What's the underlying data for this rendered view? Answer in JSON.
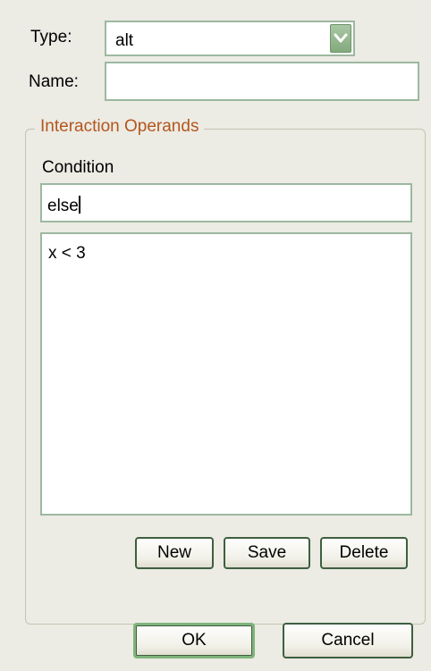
{
  "form": {
    "type_label": "Type:",
    "type_value": "alt",
    "name_label": "Name:",
    "name_value": ""
  },
  "operands": {
    "group_title": "Interaction Operands",
    "condition_label": "Condition",
    "condition_value": "else",
    "list_items": [
      "x < 3"
    ],
    "new_label": "New",
    "save_label": "Save",
    "delete_label": "Delete"
  },
  "dialog": {
    "ok_label": "OK",
    "cancel_label": "Cancel"
  },
  "icons": {
    "dropdown": "chevron-down-icon"
  }
}
